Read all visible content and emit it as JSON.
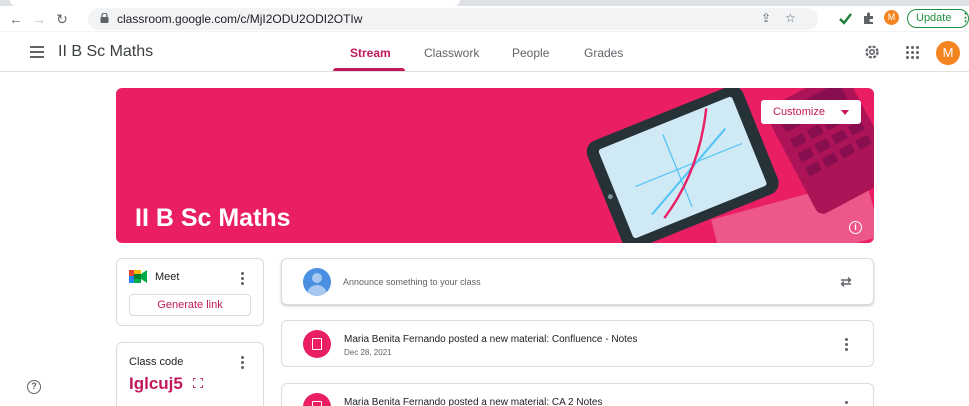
{
  "browser": {
    "url": "classroom.google.com/c/MjI2ODU2ODI2OTIw",
    "profile_initial": "M",
    "update_label": "Update"
  },
  "header": {
    "class_title": "II B Sc Maths",
    "tabs": [
      {
        "label": "Stream"
      },
      {
        "label": "Classwork"
      },
      {
        "label": "People"
      },
      {
        "label": "Grades"
      }
    ],
    "avatar_initial": "M"
  },
  "banner": {
    "title": "II B Sc Maths",
    "customize_label": "Customize"
  },
  "meet": {
    "label": "Meet",
    "generate_label": "Generate link"
  },
  "class_code": {
    "label": "Class code",
    "value": "Iglcuj5"
  },
  "announce": {
    "placeholder": "Announce something to your class"
  },
  "posts": [
    {
      "title": "Maria Benita Fernando posted a new material: Confluence - Notes",
      "date": "Dec 28, 2021"
    },
    {
      "title": "Maria Benita Fernando posted a new material: CA 2 Notes",
      "date": ""
    }
  ],
  "colors": {
    "accent": "#c2185b",
    "banner": "#e91e63",
    "avatar": "#f4841f"
  }
}
